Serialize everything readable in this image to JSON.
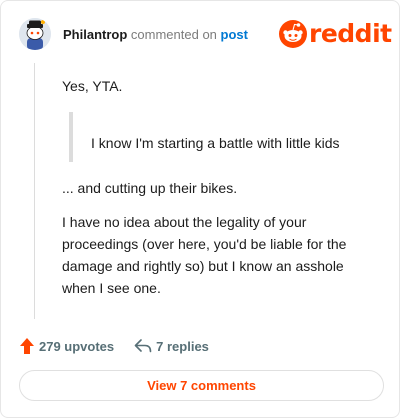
{
  "comment": {
    "username": "Philantrop",
    "action_text": "commented on",
    "post_link_label": "post",
    "avatar_icon": "snoo-avatar-icon",
    "paragraphs": {
      "p1": "Yes, YTA.",
      "quote": "I know I'm starting a battle with little kids",
      "p2": "... and cutting up their bikes.",
      "p3": "I have no idea about the legality of your proceedings (over here, you'd be liable for the damage and rightly so) but I know an asshole when I see one."
    }
  },
  "brand": {
    "wordmark": "reddit",
    "logo_icon": "reddit-logo-icon",
    "color": "#ff4500"
  },
  "stats": {
    "upvotes_label": "279 upvotes",
    "upvote_icon": "upvote-arrow-icon",
    "replies_label": "7 replies",
    "reply_icon": "reply-arrow-icon"
  },
  "view_button": {
    "label": "View 7 comments"
  },
  "colors": {
    "accent": "#ff4500",
    "link": "#0079d3",
    "muted": "#576f76"
  }
}
